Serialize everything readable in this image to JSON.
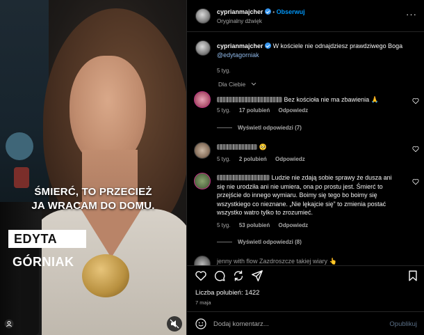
{
  "video": {
    "subtitle_line1": "ŚMIERĆ, TO PRZECIEŻ",
    "subtitle_line2": "JA WRACAM DO DOMU.",
    "name_first": "EDYTA",
    "name_last": "GÓRNIAK"
  },
  "header": {
    "username": "cyprianmajcher",
    "separator": "•",
    "follow_label": "Obserwuj",
    "audio": "Oryginalny dźwięk",
    "more": "···"
  },
  "caption": {
    "username": "cyprianmajcher",
    "text": "W kościele nie odnajdziesz prawdziwego Boga",
    "mention": "@edytagorniak",
    "time": "5 tyg."
  },
  "filter": {
    "label": "Dla Ciebie"
  },
  "comments": [
    {
      "text": "Bez kościoła nie ma zbawienia 🙏",
      "time": "5 tyg.",
      "likes": "17 polubień",
      "reply": "Odpowiedz",
      "view_replies": "Wyświetl odpowiedzi (7)"
    },
    {
      "text": "🥺",
      "time": "5 tyg.",
      "likes": "2 polubień",
      "reply": "Odpowiedz"
    },
    {
      "text_lines": [
        "Ludzie nie zdają sobie sprawy że dusza ani",
        "się nie urodziła ani nie umiera, ona po prostu jest. Śmierć to",
        "przejście do innego wymiaru. Boimy się tego bo boimy się",
        "wszystkiego co nieznane. „Nie lękajcie się” to zmienia postać",
        "wszystko watro tylko to zrozumieć."
      ],
      "time": "5 tyg.",
      "likes": "53 polubień",
      "reply": "Odpowiedz",
      "view_replies": "Wyświetl odpowiedzi (8)"
    },
    {
      "text": "jenny with flow Zazdroszcze takiej wiary 👆"
    }
  ],
  "footer": {
    "likes": "Liczba polubień: 1422",
    "date": "7 maja",
    "placeholder": "Dodaj komentarz...",
    "publish": "Opublikuj"
  },
  "colors": {
    "accent": "#0095f6",
    "muted": "#a8a8a8",
    "bg": "#000000"
  }
}
